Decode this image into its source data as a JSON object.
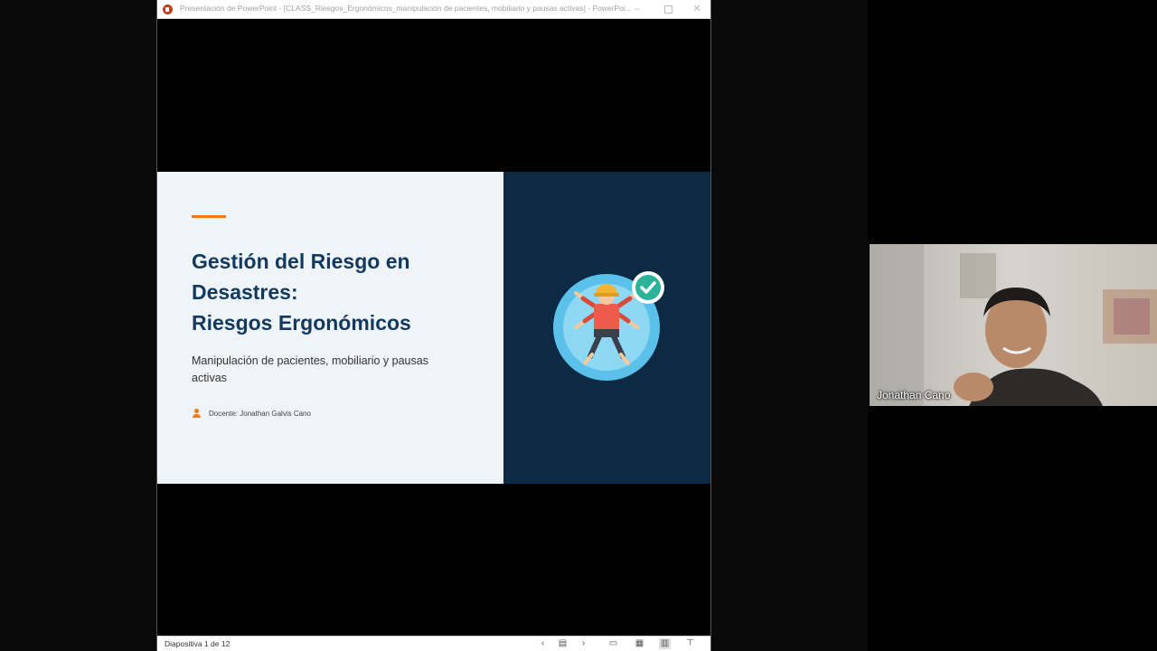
{
  "ppt": {
    "window_title": "Presentación de PowerPoint - [CLASS_Riesgos_Ergonómicos_manipulación de pacientes, mobiliario y pausas activas] - PowerPoi...",
    "status_text": "Diapositiva 1 de 12"
  },
  "slide": {
    "title_lines": [
      "Gestión del Riesgo en",
      "Desastres:",
      "Riesgos Ergonómicos"
    ],
    "subtitle": "Manipulación de pacientes, mobiliario y pausas activas",
    "teacher": "Docente: Jonathan Galvis Cano"
  },
  "participant": {
    "name": "Jonathan Cano"
  },
  "colors": {
    "slide_dark": "#0d2a45",
    "slide_light": "#eef4f8",
    "accent": "#f07a1b",
    "title": "#133a5e",
    "check_badge": "#2bb39a",
    "illustration_circle": "#5bc1ea"
  },
  "icons": {
    "app": "powerpoint-icon",
    "window_controls": [
      "minimize-icon",
      "maximize-icon",
      "close-icon"
    ],
    "statusbar": [
      "chevron-left-icon",
      "slide-menu-icon",
      "chevron-right-icon",
      "normal-view-icon",
      "slide-sorter-icon",
      "reading-view-icon",
      "slideshow-icon"
    ],
    "slide": [
      "ergonomics-figure-icon",
      "checkmark-icon",
      "person-icon"
    ]
  }
}
